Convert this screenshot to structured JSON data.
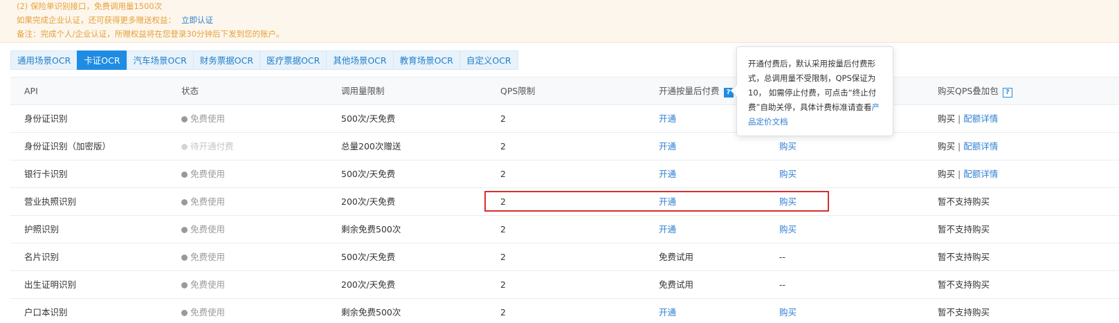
{
  "notice": {
    "line1": "(2) 保险单识别接口，免费调用量1500次",
    "line2": "如果完成企业认证，还可获得更多赠送权益：",
    "line2_link": "立即认证",
    "line3": "备注：完成个人/企业认证，所赠权益将在您登录30分钟后下发到您的账户。"
  },
  "tabs": [
    "通用场景OCR",
    "卡证OCR",
    "汽车场景OCR",
    "财务票据OCR",
    "医疗票据OCR",
    "其他场景OCR",
    "教育场景OCR",
    "自定义OCR"
  ],
  "active_tab": "卡证OCR",
  "table": {
    "headers": [
      "API",
      "状态",
      "调用量限制",
      "QPS限制",
      "开通按量后付费",
      "",
      "购买QPS叠加包"
    ],
    "help_mark": "?",
    "rows": [
      {
        "api": "身份证识别",
        "status": "免费使用",
        "limit": "500次/天免费",
        "qps": "2",
        "postpay": "开通",
        "buy": "",
        "qps_pack": "购买",
        "qps_detail": "配额详情"
      },
      {
        "api": "身份证识别（加密版）",
        "status": "待开通付费",
        "limit": "总量200次赠送",
        "qps": "2",
        "postpay": "开通",
        "buy": "购买",
        "qps_pack": "购买",
        "qps_detail": "配额详情"
      },
      {
        "api": "银行卡识别",
        "status": "免费使用",
        "limit": "500次/天免费",
        "qps": "2",
        "postpay": "开通",
        "buy": "购买",
        "qps_pack": "购买",
        "qps_detail": "配额详情"
      },
      {
        "api": "营业执照识别",
        "status": "免费使用",
        "limit": "200次/天免费",
        "qps": "2",
        "postpay": "开通",
        "buy": "购买",
        "qps_pack": "暂不支持购买",
        "qps_detail": ""
      },
      {
        "api": "护照识别",
        "status": "免费使用",
        "limit": "剩余免费500次",
        "qps": "2",
        "postpay": "开通",
        "buy": "购买",
        "qps_pack": "暂不支持购买",
        "qps_detail": ""
      },
      {
        "api": "名片识别",
        "status": "免费使用",
        "limit": "500次/天免费",
        "qps": "2",
        "postpay": "免费试用",
        "buy": "--",
        "qps_pack": "暂不支持购买",
        "qps_detail": ""
      },
      {
        "api": "出生证明识别",
        "status": "免费使用",
        "limit": "200次/天免费",
        "qps": "2",
        "postpay": "免费试用",
        "buy": "--",
        "qps_pack": "暂不支持购买",
        "qps_detail": ""
      },
      {
        "api": "户口本识别",
        "status": "免费使用",
        "limit": "剩余免费500次",
        "qps": "2",
        "postpay": "开通",
        "buy": "购买",
        "qps_pack": "暂不支持购买",
        "qps_detail": ""
      }
    ],
    "sep": "|"
  },
  "popover": {
    "text": "开通付费后，默认采用按量后付费形式，总调用量不受限制，QPS保证为10， 如需停止付费，可点击“终止付费”自助关停，具体计费标准请查看",
    "link": "产品定价文档"
  },
  "colors": {
    "accent": "#1f8ce3",
    "link": "#2f7fd4",
    "warning": "#e6a23c",
    "highlight": "#d82e2e"
  }
}
